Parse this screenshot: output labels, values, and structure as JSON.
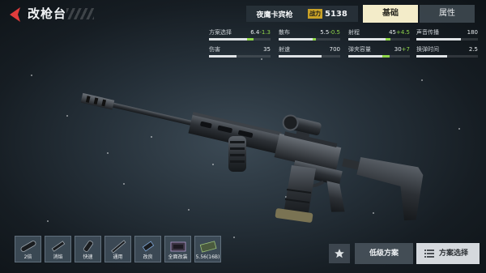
{
  "header": {
    "title": "改枪台",
    "weapon_name": "夜鹰卡宾枪",
    "power_label": "战力",
    "power_value": "5138"
  },
  "tabs": [
    {
      "label": "基础",
      "active": true
    },
    {
      "label": "属性",
      "active": false
    }
  ],
  "stats": [
    {
      "label": "方案选择",
      "base": "6.4",
      "bonus": "-1.3",
      "fill": 0.62,
      "bonus_fill": 0.1
    },
    {
      "label": "散布",
      "base": "5.5",
      "bonus": "-0.5",
      "fill": 0.55,
      "bonus_fill": 0.05
    },
    {
      "label": "射程",
      "base": "45",
      "bonus": "+4.5",
      "fill": 0.6,
      "bonus_fill": 0.08
    },
    {
      "label": "声音传播",
      "base": "180",
      "bonus": "",
      "fill": 0.72,
      "bonus_fill": 0
    },
    {
      "label": "伤害",
      "base": "35",
      "bonus": "",
      "fill": 0.45,
      "bonus_fill": 0
    },
    {
      "label": "射速",
      "base": "700",
      "bonus": "",
      "fill": 0.7,
      "bonus_fill": 0
    },
    {
      "label": "弹夹容量",
      "base": "30",
      "bonus": "+7",
      "fill": 0.55,
      "bonus_fill": 0.12
    },
    {
      "label": "换弹时间",
      "base": "2.5",
      "bonus": "",
      "fill": 0.5,
      "bonus_fill": 0
    }
  ],
  "attachments": [
    {
      "label": "2倍",
      "icon": "scope-icon"
    },
    {
      "label": "消焰",
      "icon": "flash-hider-icon"
    },
    {
      "label": "快速",
      "icon": "grip-icon"
    },
    {
      "label": "通用",
      "icon": "barrel-icon"
    },
    {
      "label": "改良",
      "icon": "muzzle-icon"
    },
    {
      "label": "全面改装",
      "icon": "kit-icon"
    },
    {
      "label": "5.56(16B)",
      "icon": "ammo-icon"
    }
  ],
  "buttons": {
    "low_plan": "低级方案",
    "plan_select": "方案选择"
  },
  "colors": {
    "accent": "#c9a227",
    "bonus": "#8fd64a",
    "back_arrow": "#e03c3c",
    "active_tab": "#f3ecc9"
  }
}
